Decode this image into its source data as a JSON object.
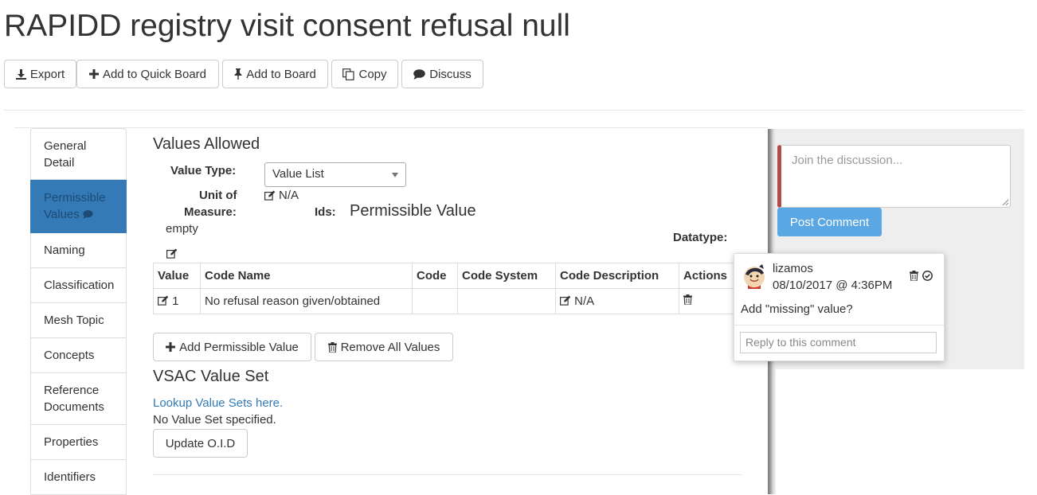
{
  "page": {
    "title": "RAPIDD registry visit consent refusal null"
  },
  "toolbar": {
    "export": "Export",
    "add_quick_board": "Add to Quick Board",
    "add_board": "Add to Board",
    "copy": "Copy",
    "discuss": "Discuss"
  },
  "sidebar": {
    "items": [
      {
        "label": "General Detail"
      },
      {
        "label": "Permissible Values"
      },
      {
        "label": "Naming"
      },
      {
        "label": "Classification"
      },
      {
        "label": "Mesh Topic"
      },
      {
        "label": "Concepts"
      },
      {
        "label": "Reference Documents"
      },
      {
        "label": "Properties"
      },
      {
        "label": "Identifiers"
      }
    ]
  },
  "values_allowed": {
    "heading": "Values Allowed",
    "value_type_label": "Value Type:",
    "value_type": "Value List",
    "unit_label_1": "Unit of",
    "unit_label_2": "Measure:",
    "unit_value": "N/A",
    "unit_empty": "empty",
    "ids_label": "Ids:",
    "pv_heading": "Permissible Value",
    "datatype_label": "Datatype:"
  },
  "table": {
    "headers": [
      "Value",
      "Code Name",
      "Code",
      "Code System",
      "Code Description",
      "Actions"
    ],
    "rows": [
      {
        "value": "1",
        "code_name": "No refusal reason given/obtained",
        "code": "",
        "code_system": "",
        "code_description": "N/A"
      }
    ]
  },
  "buttons": {
    "add_pv": "Add Permissible Value",
    "remove_all": "Remove All Values"
  },
  "vsac": {
    "heading": "VSAC Value Set",
    "lookup_link": "Lookup Value Sets here.",
    "none_text": "No Value Set specified.",
    "update_button": "Update O.I.D"
  },
  "discussion": {
    "placeholder": "Join the discussion...",
    "post_button": "Post Comment",
    "comment": {
      "author": "lizamos",
      "timestamp": "08/10/2017 @ 4:36PM",
      "text": "Add \"missing\" value?",
      "reply_placeholder": "Reply to this comment"
    }
  },
  "colors": {
    "active_tab": "#337ab7",
    "link": "#337ab7",
    "post_button": "#5aa7e3",
    "textarea_accent": "#b54a4a"
  },
  "icons": [
    "download-icon",
    "plus-icon",
    "pin-icon",
    "copy-icon",
    "comment-icon",
    "edit-icon",
    "trash-icon",
    "check-circle-icon",
    "avatar"
  ]
}
